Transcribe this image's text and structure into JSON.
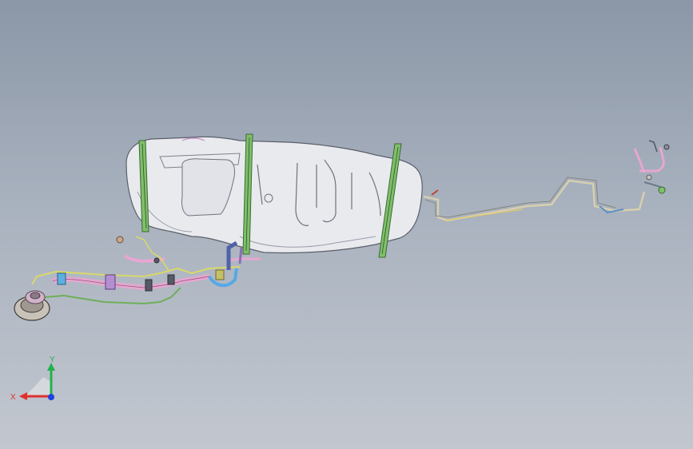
{
  "viewport": {
    "background_top": "#8b97a7",
    "background_bottom": "#c2c7cf"
  },
  "model": {
    "parts": [
      {
        "name": "fuel-tank",
        "color": "#e9eaee"
      },
      {
        "name": "tank-strap",
        "color": "#7fbf6a"
      },
      {
        "name": "filler-pipe",
        "color": "#e7a6d0"
      },
      {
        "name": "vent-line",
        "color": "#d9d86a"
      },
      {
        "name": "return-line",
        "color": "#6fae5a"
      },
      {
        "name": "filler-neck",
        "color": "#c9c2b8"
      },
      {
        "name": "fuel-feed-line",
        "color": "#d8cfae"
      },
      {
        "name": "blue-hose",
        "color": "#55a9e6"
      }
    ]
  },
  "triad": {
    "x_label": "X",
    "y_label": "Y",
    "x_color": "#e03030",
    "y_color": "#22b14c",
    "z_color": "#2040e0"
  }
}
